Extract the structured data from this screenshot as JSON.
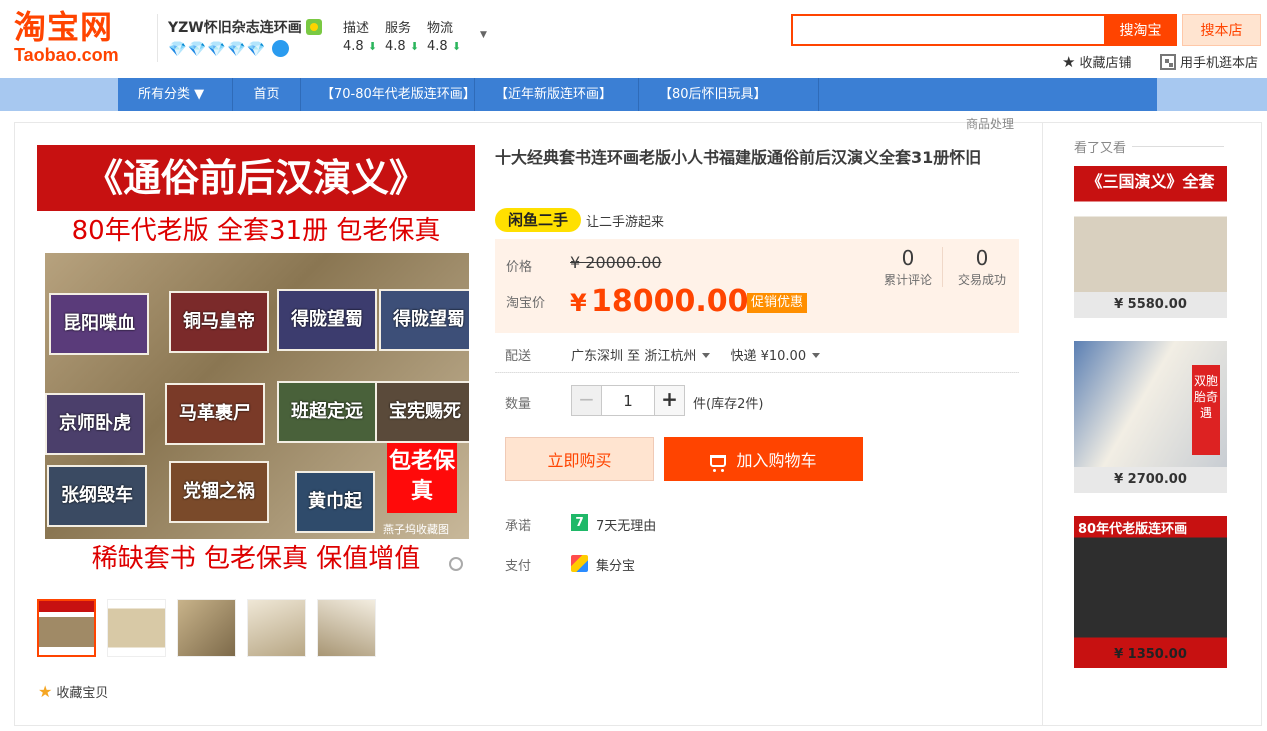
{
  "header": {
    "logo_cn": "淘宝网",
    "logo_en": "Taobao.com",
    "shop_name": "YZW怀旧杂志连环画",
    "shop_level": "💎💎💎💎💎",
    "ratings": [
      {
        "label": "描述",
        "value": "4.8"
      },
      {
        "label": "服务",
        "value": "4.8"
      },
      {
        "label": "物流",
        "value": "4.8"
      }
    ],
    "search_placeholder": "",
    "search_taobao_label": "搜淘宝",
    "search_shop_label": "搜本店",
    "favorite_shop_label": "收藏店铺",
    "mobile_shop_label": "用手机逛本店"
  },
  "nav": {
    "items": [
      {
        "label": "所有分类 ▼"
      },
      {
        "label": "首页"
      },
      {
        "label": "【70-80年代老版连环画】"
      },
      {
        "label": "【近年新版连环画】"
      },
      {
        "label": "【80后怀旧玩具】"
      }
    ]
  },
  "goods_handle_label": "商品处理",
  "main_image": {
    "title": "《通俗前后汉演义》",
    "line2": "80年代老版  全套31册  包老保真",
    "books": [
      "昆阳喋血",
      "铜马皇帝",
      "得陇望蜀",
      "得陇望蜀",
      "京师卧虎",
      "马革裹尸",
      "班超定远",
      "宝宪赐死",
      "张纲毁车",
      "党锢之祸",
      "黄巾起"
    ],
    "stamp": "包老保真",
    "watermark": "燕子坞收藏图",
    "bottom": "稀缺套书  包老保真  保值增值"
  },
  "favorite_item_label": "收藏宝贝",
  "product": {
    "title": "十大经典套书连环画老版小人书福建版通俗前后汉演义全套31册怀旧",
    "xianyu_badge": "闲鱼二手",
    "xianyu_slogan": "让二手游起来",
    "price_label": "价格",
    "price_original": "¥ 20000.00",
    "taobao_price_label": "淘宝价",
    "currency": "¥",
    "taobao_price": "18000.00",
    "promo_label": "促销优惠",
    "reviews_count": "0",
    "reviews_label": "累计评论",
    "deals_count": "0",
    "deals_label": "交易成功",
    "shipping_label": "配送",
    "ship_from": "广东深圳",
    "ship_to_word": "至",
    "ship_to": "浙江杭州",
    "ship_method": "快递 ¥10.00",
    "quantity_label": "数量",
    "quantity_value": "1",
    "stock_text": "件(库存2件)",
    "buy_now_label": "立即购买",
    "add_cart_label": "加入购物车",
    "promise_label": "承诺",
    "promise_icon": "7",
    "promise_text": "7天无理由",
    "pay_label": "支付",
    "pay_text": "集分宝"
  },
  "also_viewed": {
    "title": "看了又看",
    "items": [
      {
        "caption": "《三国演义》全套",
        "price": "¥ 5580.00"
      },
      {
        "caption": "双胞胎奇遇",
        "price": "¥ 2700.00"
      },
      {
        "caption": "80年代老版连环画",
        "price": "¥ 1350.00"
      }
    ]
  },
  "colors": {
    "brand": "#ff4400",
    "nav": "#3b7fd4",
    "price_panel": "#fff2e8"
  }
}
